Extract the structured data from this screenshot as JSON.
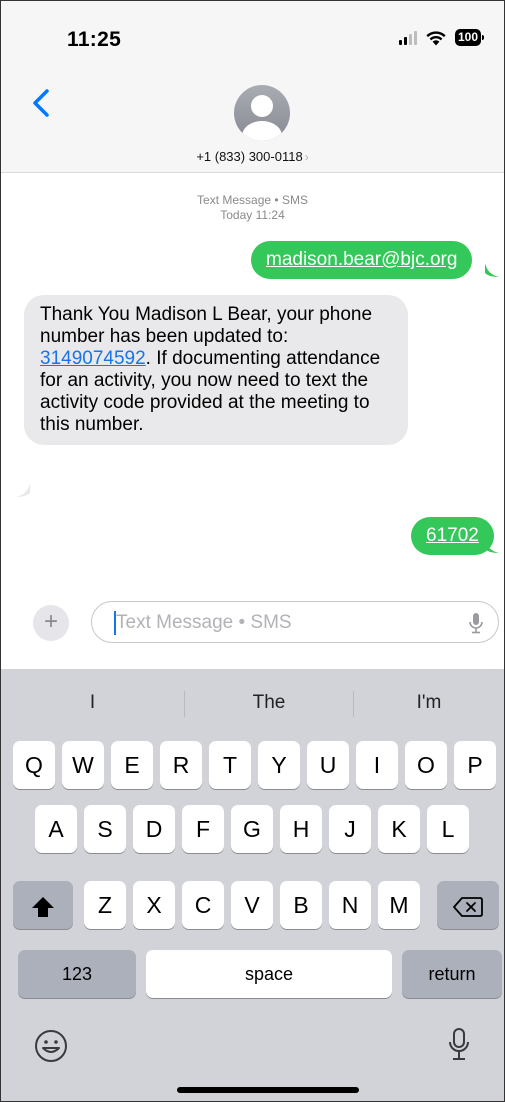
{
  "status_bar": {
    "time": "11:25",
    "battery": "100"
  },
  "header": {
    "contact": "+1 (833) 300-0118",
    "chevron": "›"
  },
  "transcript": {
    "service": "Text Message • SMS",
    "timestamp": "Today 11:24"
  },
  "messages": [
    {
      "direction": "outgoing",
      "text": "madison.bear@bjc.org"
    },
    {
      "direction": "incoming",
      "text_before_link": "Thank You Madison L Bear, your phone number has been updated to: ",
      "link": "3149074592",
      "text_after_link": ". If documenting attendance for an activity, you now need to text the activity code provided at the meeting to this number."
    },
    {
      "direction": "outgoing",
      "text": "61702"
    }
  ],
  "composer": {
    "plus": "+",
    "placeholder": "Text Message • SMS"
  },
  "keyboard": {
    "suggestions": [
      "I",
      "The",
      "I'm"
    ],
    "row1": [
      "Q",
      "W",
      "E",
      "R",
      "T",
      "Y",
      "U",
      "I",
      "O",
      "P"
    ],
    "row2": [
      "A",
      "S",
      "D",
      "F",
      "G",
      "H",
      "J",
      "K",
      "L"
    ],
    "row3": [
      "Z",
      "X",
      "C",
      "V",
      "B",
      "N",
      "M"
    ],
    "numbers": "123",
    "space": "space",
    "return": "return"
  },
  "colors": {
    "outgoing_bubble": "#34c759",
    "incoming_bubble": "#e9e9eb",
    "link": "#1a73e8",
    "accent": "#007aff"
  },
  "icons": [
    "back-chevron-icon",
    "avatar-icon",
    "signal-icon",
    "wifi-icon",
    "battery-icon",
    "plus-icon",
    "mic-icon",
    "shift-icon",
    "backspace-icon",
    "emoji-icon",
    "dictation-icon"
  ]
}
